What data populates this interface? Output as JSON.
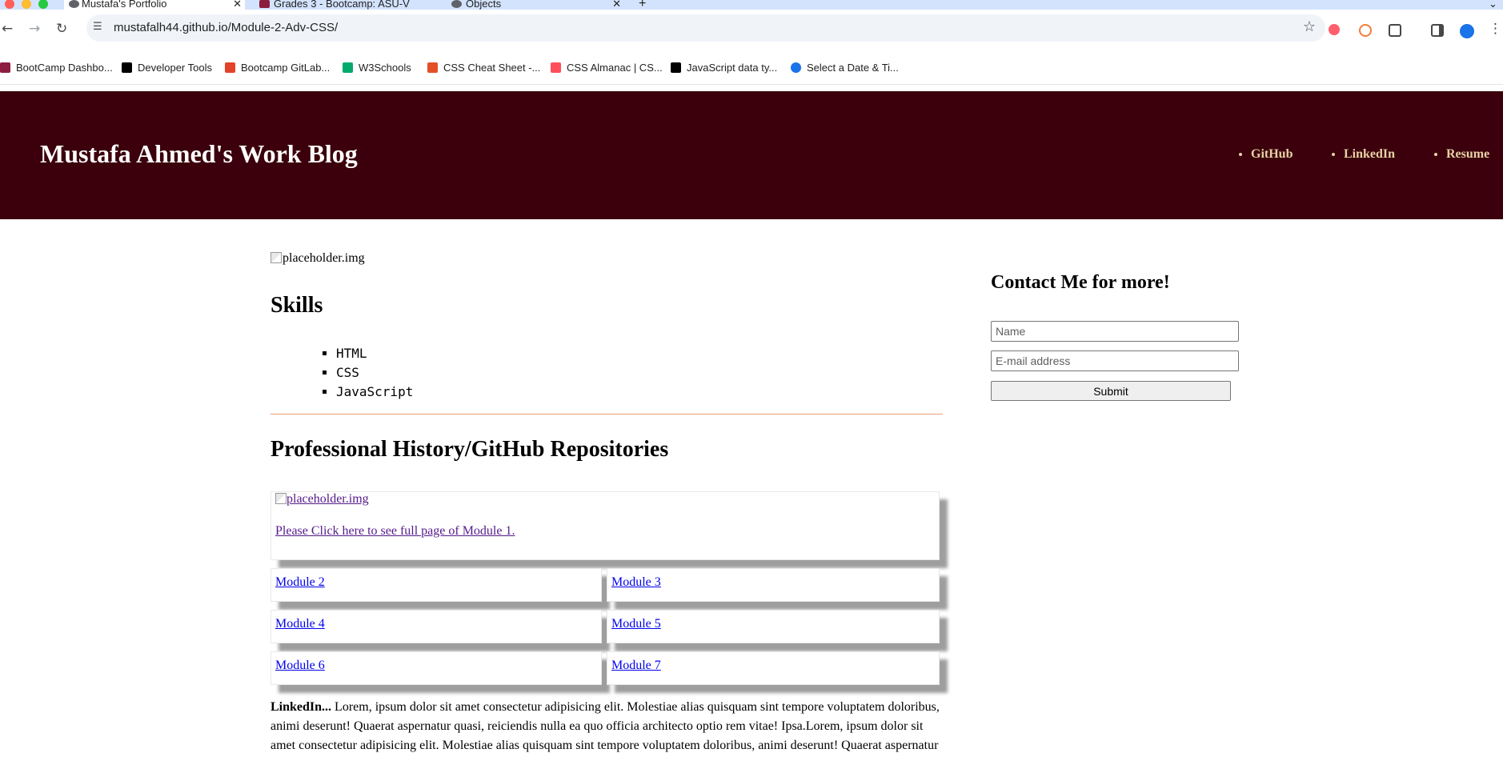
{
  "browser": {
    "tabs": [
      {
        "title": "Mustafa's Portfolio",
        "active": true
      },
      {
        "title": "Grades 3 - Bootcamp: ASU-V",
        "active": false
      },
      {
        "title": "Objects",
        "active": false
      }
    ],
    "new_tab_glyph": "+",
    "url": "mustafalh44.github.io/Module-2-Adv-CSS/",
    "bookmarks": [
      {
        "label": "BootCamp Dashbo...",
        "icon": "asu-icon",
        "color": "#8c1d40"
      },
      {
        "label": "Developer Tools",
        "icon": "m-icon",
        "color": "#000000"
      },
      {
        "label": "Bootcamp GitLab...",
        "icon": "gitlab-icon",
        "color": "#e24329"
      },
      {
        "label": "W3Schools",
        "icon": "w3-icon",
        "color": "#04aa6d"
      },
      {
        "label": "CSS Cheat Sheet -...",
        "icon": "html5-icon",
        "color": "#e34f26"
      },
      {
        "label": "CSS Almanac | CS...",
        "icon": "asterisk-icon",
        "color": "#ff4f5a"
      },
      {
        "label": "JavaScript data ty...",
        "icon": "m-icon",
        "color": "#000000"
      },
      {
        "label": "Select a Date & Ti...",
        "icon": "calendar-circle-icon",
        "color": "#1a73e8"
      }
    ]
  },
  "header": {
    "title": "Mustafa Ahmed's Work Blog",
    "nav": [
      "GitHub",
      "LinkedIn",
      "Resume"
    ],
    "background": "#3b000b",
    "link_color": "#e8d2a6"
  },
  "main": {
    "hero_alt": "placeholder.img",
    "skills_heading": "Skills",
    "skills": [
      "HTML",
      "CSS",
      "JavaScript"
    ],
    "history_heading": "Professional History/GitHub Repositories",
    "featured": {
      "img_alt": "placeholder.img",
      "link_text": "Please Click here to see full page of Module 1."
    },
    "modules": [
      "Module 2",
      "Module 3",
      "Module 4",
      "Module 5",
      "Module 6",
      "Module 7"
    ],
    "about_label": "LinkedIn...",
    "about_text": " Lorem, ipsum dolor sit amet consectetur adipisicing elit. Molestiae alias quisquam sint tempore voluptatem doloribus, animi deserunt! Quaerat aspernatur quasi, reiciendis nulla ea quo officia architecto optio rem vitae! Ipsa.Lorem, ipsum dolor sit amet consectetur adipisicing elit. Molestiae alias quisquam sint tempore voluptatem doloribus, animi deserunt! Quaerat aspernatur"
  },
  "contact": {
    "heading": "Contact Me for more!",
    "name_placeholder": "Name",
    "email_placeholder": "E-mail address",
    "submit_label": "Submit"
  }
}
